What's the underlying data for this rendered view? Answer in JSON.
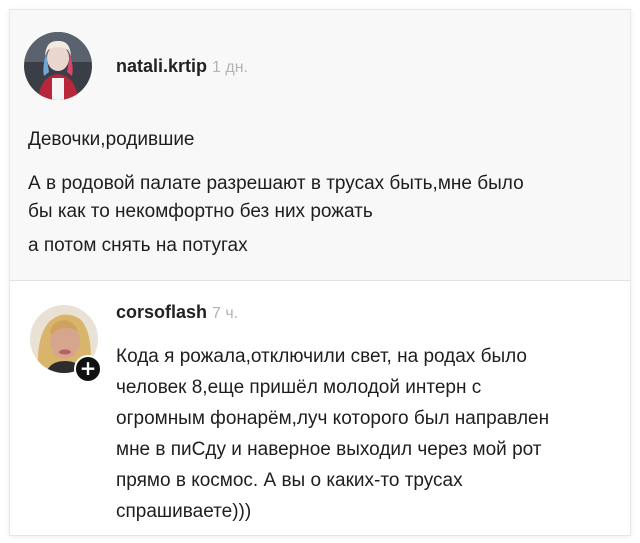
{
  "post": {
    "author": "natali.krtip",
    "time": "1 дн.",
    "lines": [
      "Девочки,родившие",
      "А в родовой палате разрешают в трусах быть,мне было",
      "бы как то некомфортно без них рожать",
      "а потом снять на потугах"
    ]
  },
  "reply": {
    "author": "corsoflash",
    "time": "7 ч.",
    "lines": [
      "Кода я рожала,отключили свет, на родах было",
      "человек 8,еще  пришёл  молодой интерн  с",
      "огромным фонарём,луч которого  был направлен",
      "мне в пиСду и наверное выходил  через  мой рот",
      "прямо  в космос. А вы о каких-то трусах",
      "спрашиваете)))"
    ],
    "follow_icon": "plus-icon"
  }
}
